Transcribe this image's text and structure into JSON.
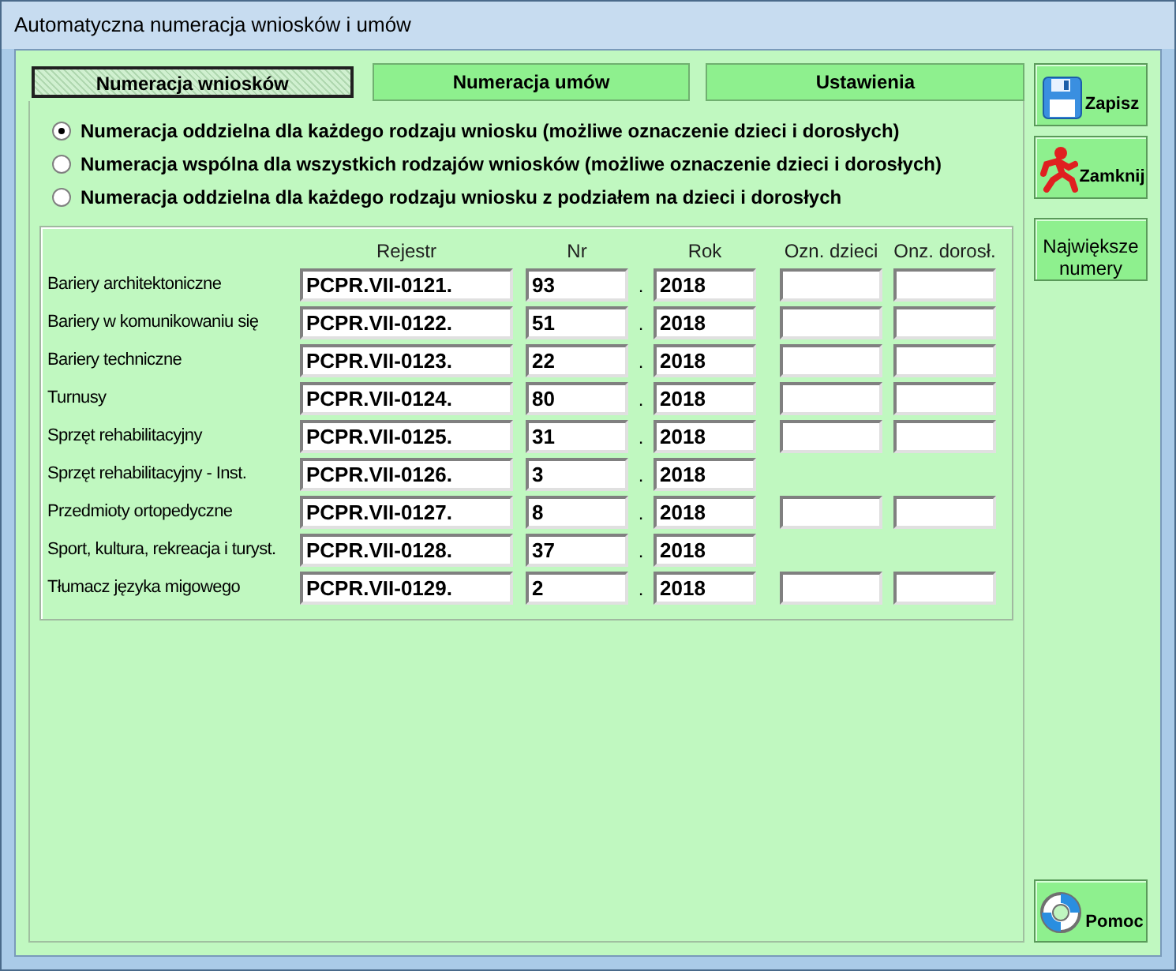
{
  "window": {
    "title": "Automatyczna numeracja wniosków i umów"
  },
  "tabs": [
    {
      "label": "Numeracja wniosków",
      "selected": true
    },
    {
      "label": "Numeracja umów",
      "selected": false
    },
    {
      "label": "Ustawienia",
      "selected": false
    }
  ],
  "numbering_modes": [
    {
      "label": "Numeracja oddzielna dla każdego rodzaju wniosku (możliwe oznaczenie dzieci i dorosłych)",
      "selected": true
    },
    {
      "label": "Numeracja wspólna dla wszystkich rodzajów wniosków (możliwe oznaczenie dzieci i dorosłych)",
      "selected": false
    },
    {
      "label": "Numeracja oddzielna dla każdego rodzaju wniosku z podziałem na dzieci i dorosłych",
      "selected": false
    }
  ],
  "table": {
    "columns": [
      "Rejestr",
      "Nr",
      "Rok",
      "Ozn. dzieci",
      "Onz. dorosł."
    ],
    "rows": [
      {
        "name": "Bariery architektoniczne",
        "rejestr": "PCPR.VII-0121.",
        "nr": "93",
        "separator": ".",
        "rok": "2018",
        "kind": "full"
      },
      {
        "name": "Bariery w komunikowaniu się",
        "rejestr": "PCPR.VII-0122.",
        "nr": "51",
        "separator": ".",
        "rok": "2018",
        "kind": "full"
      },
      {
        "name": "Bariery techniczne",
        "rejestr": "PCPR.VII-0123.",
        "nr": "22",
        "separator": ".",
        "rok": "2018",
        "kind": "full"
      },
      {
        "name": "Turnusy",
        "rejestr": "PCPR.VII-0124.",
        "nr": "80",
        "separator": ".",
        "rok": "2018",
        "kind": "full"
      },
      {
        "name": "Sprzęt rehabilitacyjny",
        "rejestr": "PCPR.VII-0125.",
        "nr": "31",
        "separator": ".",
        "rok": "2018",
        "kind": "full"
      },
      {
        "name": "Sprzęt rehabilitacyjny - Inst.",
        "rejestr": "PCPR.VII-0126.",
        "nr": "3",
        "separator": ".",
        "rok": "2018",
        "kind": "basic"
      },
      {
        "name": "Przedmioty ortopedyczne",
        "rejestr": "PCPR.VII-0127.",
        "nr": "8",
        "separator": ".",
        "rok": "2018",
        "kind": "full"
      },
      {
        "name": "Sport, kultura, rekreacja i turyst.",
        "rejestr": "PCPR.VII-0128.",
        "nr": "37",
        "separator": ".",
        "rok": "2018",
        "kind": "basic"
      },
      {
        "name": "Tłumacz języka migowego",
        "rejestr": "PCPR.VII-0129.",
        "nr": "2",
        "separator": ".",
        "rok": "2018",
        "kind": "full"
      }
    ]
  },
  "side_buttons": [
    {
      "label": "Zapisz",
      "kind": "save"
    },
    {
      "label": "Zamknij",
      "kind": "close"
    },
    {
      "label": "Największe numery",
      "kind": "text"
    }
  ],
  "help_button": {
    "label": "Pomoc"
  }
}
